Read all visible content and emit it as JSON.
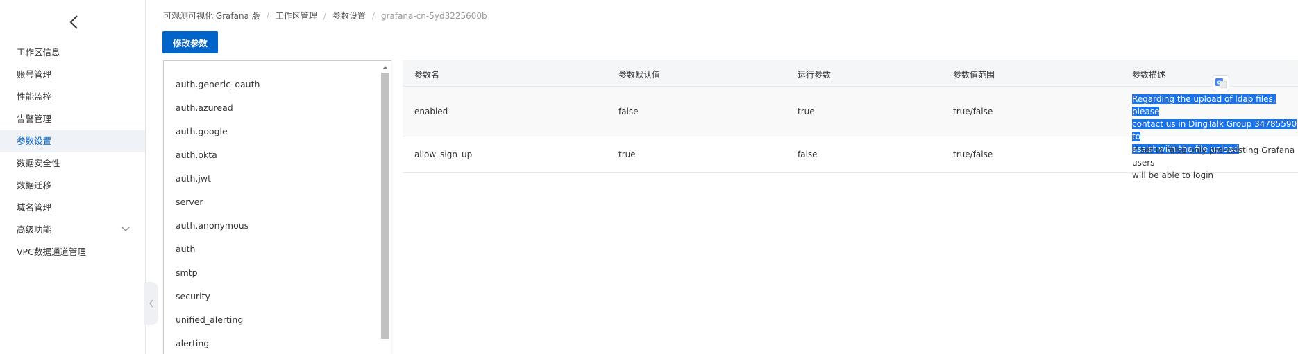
{
  "sidebar": {
    "back_icon": "chevron-left-icon",
    "items": [
      {
        "label": "工作区信息"
      },
      {
        "label": "账号管理"
      },
      {
        "label": "性能监控"
      },
      {
        "label": "告警管理"
      },
      {
        "label": "参数设置",
        "active": true
      },
      {
        "label": "数据安全性"
      },
      {
        "label": "数据迁移"
      },
      {
        "label": "域名管理"
      },
      {
        "label": "高级功能",
        "expandable": true
      },
      {
        "label": "VPC数据通道管理"
      }
    ]
  },
  "breadcrumb": [
    "可观测可视化 Grafana 版",
    "工作区管理",
    "参数设置",
    "grafana-cn-5yd3225600b"
  ],
  "toolbar": {
    "modify_label": "修改参数"
  },
  "sections": [
    "auth.generic_oauth",
    "auth.azuread",
    "auth.google",
    "auth.okta",
    "auth.jwt",
    "server",
    "auth.anonymous",
    "auth",
    "smtp",
    "security",
    "unified_alerting",
    "alerting"
  ],
  "table": {
    "headers": [
      "参数名",
      "参数默认值",
      "运行参数",
      "参数值范围",
      "参数描述"
    ],
    "rows": [
      {
        "name": "enabled",
        "default": "false",
        "running": "true",
        "range": "true/false",
        "desc_lines": [
          "Regarding the upload of ldap files, please",
          "contact us in DingTalk Group 34785590 to",
          "assist with the file upload"
        ]
      },
      {
        "name": "allow_sign_up",
        "default": "true",
        "running": "false",
        "range": "true/false",
        "desc_lines": [
          "If set to false only pre-existing Grafana users",
          "will be able to login"
        ]
      }
    ]
  },
  "colors": {
    "primary": "#0064c8",
    "selection": "#1a73e8"
  }
}
